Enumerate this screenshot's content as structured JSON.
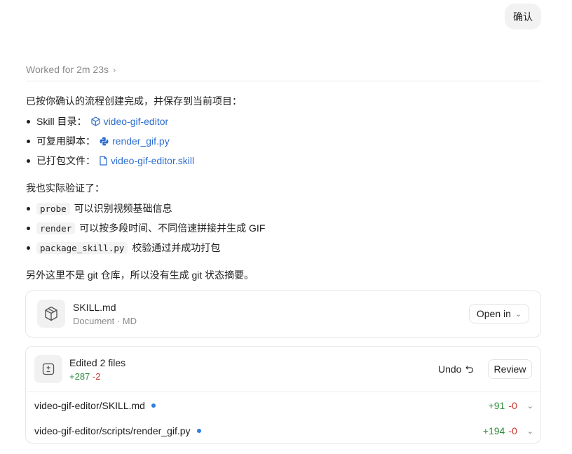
{
  "user_message": "确认",
  "worked": {
    "label": "Worked for 2m 23s"
  },
  "summary": {
    "intro": "已按你确认的流程创建完成，并保存到当前项目：",
    "items": [
      {
        "label": "Skill 目录：",
        "link": "video-gif-editor",
        "icon": "package-icon"
      },
      {
        "label": "可复用脚本：",
        "link": "render_gif.py",
        "icon": "python-icon"
      },
      {
        "label": "已打包文件：",
        "link": "video-gif-editor.skill",
        "icon": "file-icon"
      }
    ],
    "verified_intro": "我也实际验证了：",
    "verified": [
      {
        "code": "probe",
        "text": "可以识别视频基础信息"
      },
      {
        "code": "render",
        "text": "可以按多段时间、不同倍速拼接并生成 GIF"
      },
      {
        "code": "package_skill.py",
        "text": "校验通过并成功打包"
      }
    ],
    "note": "另外这里不是 git 仓库，所以没有生成 git 状态摘要。"
  },
  "document_card": {
    "title": "SKILL.md",
    "subtitle": "Document · MD",
    "open_label": "Open in",
    "icon": "cube-icon"
  },
  "edits_card": {
    "title": "Edited 2 files",
    "added": "+287",
    "removed": "-2",
    "undo_label": "Undo",
    "review_label": "Review",
    "icon": "diff-icon",
    "files": [
      {
        "path": "video-gif-editor/SKILL.md",
        "added": "+91",
        "removed": "-0"
      },
      {
        "path": "video-gif-editor/scripts/render_gif.py",
        "added": "+194",
        "removed": "-0"
      }
    ]
  },
  "colors": {
    "link": "#2d6ecf",
    "added": "#2e8b3d",
    "removed": "#c8352c",
    "dot": "#2e7fe0"
  }
}
